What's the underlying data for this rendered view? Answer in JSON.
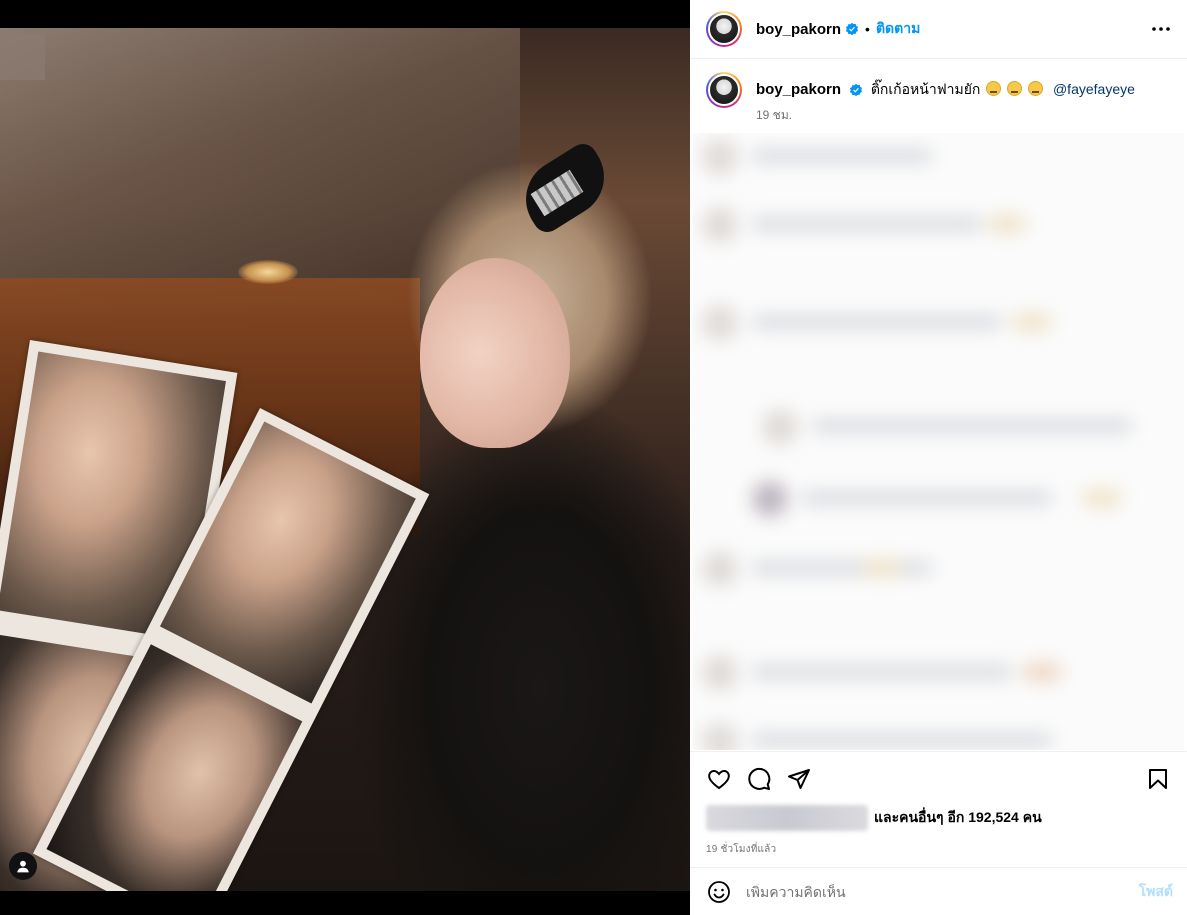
{
  "post": {
    "username": "boy_pakorn",
    "follow_label": "ติดตาม",
    "separator": "•",
    "caption_text": "ติ๊กเก้อหน้าฟามยัก",
    "mention": "@fayefayeye",
    "caption_time": "19 ชม.",
    "likes_text": "และคนอื่นๆ อีก 192,524 คน",
    "post_time": "19 ชั่วโมงที่แล้ว"
  },
  "comment_box": {
    "placeholder": "เพิ่มความคิดเห็น",
    "post_label": "โพสต์"
  },
  "icons": {
    "verified": "verified-badge-icon",
    "more": "more-options-icon",
    "like": "heart-icon",
    "comment": "comment-bubble-icon",
    "share": "paper-plane-icon",
    "save": "bookmark-icon",
    "emoji": "smiley-icon",
    "tagged": "user-tag-icon"
  },
  "colors": {
    "accent": "#0095f6",
    "mention": "#00376b",
    "post_disabled": "#b2dffc",
    "muted": "#737373"
  }
}
